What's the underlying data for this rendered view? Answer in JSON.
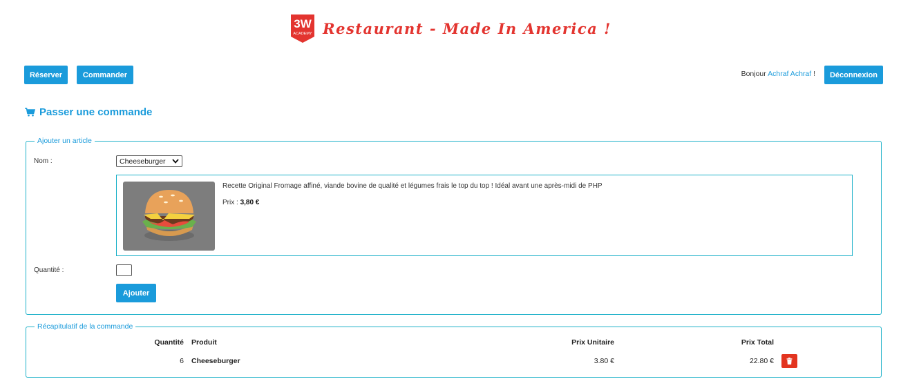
{
  "header": {
    "logo_text": "3W",
    "logo_sub": "ACADEMY",
    "title": "Restaurant - Made In America !"
  },
  "nav": {
    "reserve_label": "Réserver",
    "order_label": "Commander",
    "greeting_prefix": "Bonjour",
    "user_name": "Achraf Achraf",
    "greeting_suffix": "!",
    "logout_label": "Déconnexion"
  },
  "page": {
    "title": "Passer une commande",
    "icon": "shopping-cart-icon"
  },
  "add_article": {
    "legend": "Ajouter un article",
    "name_label": "Nom :",
    "selected_product": "Cheeseburger",
    "description": "Recette Original Fromage affiné, viande bovine de qualité et légumes frais le top du top ! Idéal avant une après-midi de PHP",
    "price_label": "Prix :",
    "price_value": "3,80 €",
    "quantity_label": "Quantité :",
    "quantity_value": "",
    "add_button": "Ajouter"
  },
  "recap": {
    "legend": "Récapitulatif de la commande",
    "columns": {
      "quantity": "Quantité",
      "product": "Produit",
      "unit_price": "Prix Unitaire",
      "total_price": "Prix Total"
    },
    "rows": [
      {
        "quantity": "6",
        "product": "Cheeseburger",
        "unit_price": "3.80 €",
        "total_price": "22.80 €"
      }
    ]
  },
  "colors": {
    "accent": "#1a9bdb",
    "border": "#1ab0c8",
    "brand_red": "#e3342f",
    "danger": "#e3341f"
  }
}
